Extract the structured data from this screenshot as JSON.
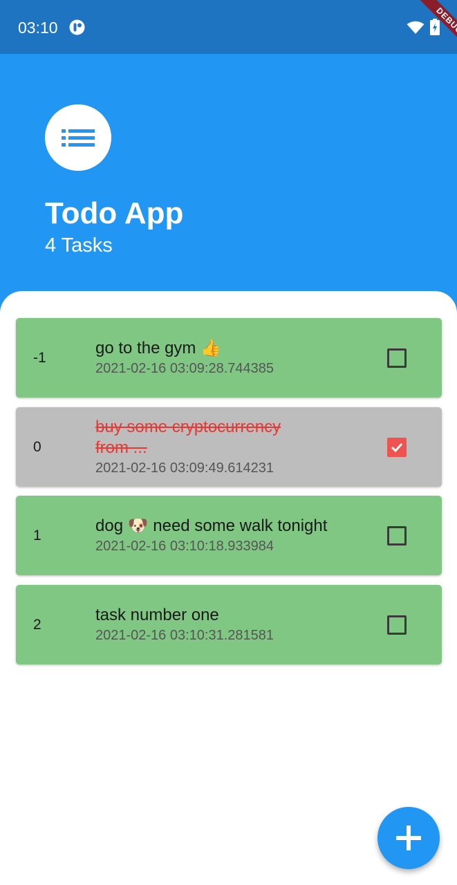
{
  "status_bar": {
    "time": "03:10",
    "app_icon": "app-notification-icon",
    "wifi_icon": "wifi-icon",
    "battery_icon": "battery-icon",
    "debug_label": "DEBUG"
  },
  "header": {
    "icon": "list-icon",
    "title": "Todo App",
    "subtitle": "4 Tasks"
  },
  "tasks": [
    {
      "index": "-1",
      "title": "go to the gym 👍",
      "time": "2021-02-16 03:09:28.744385",
      "done": false
    },
    {
      "index": "0",
      "title": "buy some cryptocurrency from ...",
      "time": "2021-02-16 03:09:49.614231",
      "done": true
    },
    {
      "index": "1",
      "title": "dog 🐶 need some walk tonight",
      "time": "2021-02-16 03:10:18.933984",
      "done": false
    },
    {
      "index": "2",
      "title": "task number one",
      "time": "2021-02-16 03:10:31.281581",
      "done": false
    }
  ],
  "fab": {
    "icon": "plus-icon"
  },
  "colors": {
    "status_bar": "#1e74c1",
    "header": "#2196f3",
    "task_open": "#81c784",
    "task_done": "#bdbdbd",
    "done_text": "#e53935",
    "checkbox_checked": "#ef5350"
  }
}
